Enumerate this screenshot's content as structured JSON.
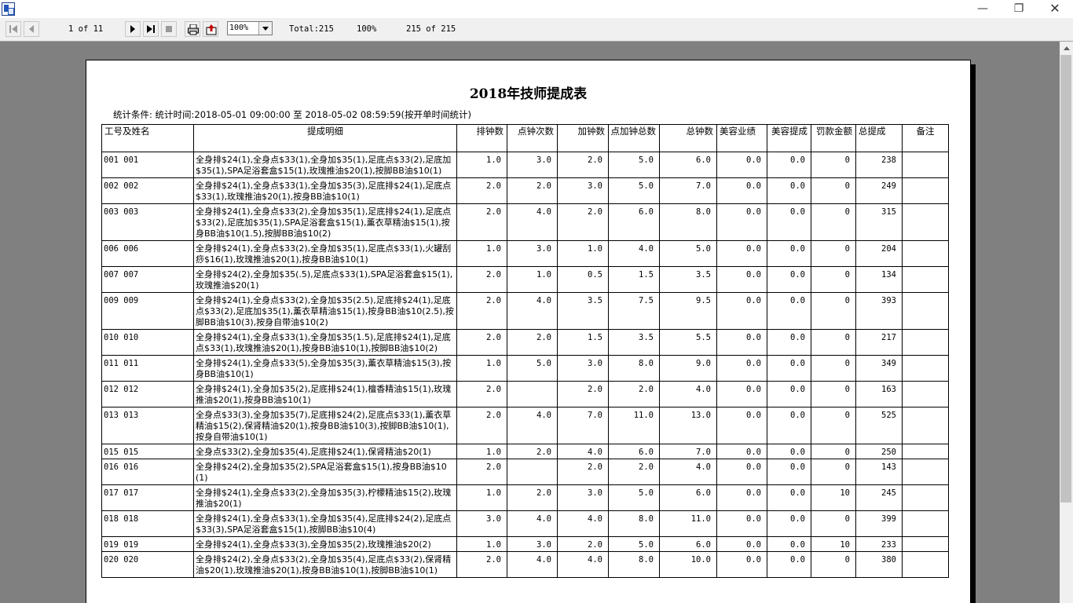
{
  "window": {
    "min_glyph": "—",
    "max_glyph": "❐",
    "close_glyph": "✕"
  },
  "icons": {
    "app": "report-viewer-icon",
    "first": "first-page-icon",
    "prev": "previous-page-icon",
    "next": "next-page-icon",
    "last": "last-page-icon",
    "stop": "stop-icon",
    "print": "printer-icon",
    "export": "export-icon"
  },
  "toolbar": {
    "page_indicator": "1 of 11",
    "zoom_value": "100%",
    "total": "Total:215",
    "percent": "100%",
    "records": "215 of 215"
  },
  "report": {
    "title": "2018年技师提成表",
    "condition": "统计条件: 统计时间:2018-05-01 09:00:00 至 2018-05-02 08:59:59(按开单时间统计)",
    "columns": [
      "工号及姓名",
      "提成明细",
      "排钟数",
      "点钟次数",
      "加钟数",
      "点加钟总数",
      "总钟数",
      "美容业绩",
      "美容提成",
      "罚款金额",
      "总提成",
      "备注"
    ],
    "rows": [
      {
        "id": "001 001",
        "detail": "全身排$24(1),全身点$33(1),全身加$35(1),足底点$33(2),足底加$35(1),SPA足浴套盒$15(1),玫瑰推油$20(1),按脚BB油$10(1)",
        "pai": "1.0",
        "dianci": "3.0",
        "jia": "2.0",
        "djz": "5.0",
        "zong": "6.0",
        "mryj": "0.0",
        "mrtc": "0.0",
        "fk": "0",
        "ztc": "238",
        "bz": ""
      },
      {
        "id": "002 002",
        "detail": "全身排$24(1),全身点$33(1),全身加$35(3),足底排$24(1),足底点$33(1),玫瑰推油$20(1),按身BB油$10(1)",
        "pai": "2.0",
        "dianci": "2.0",
        "jia": "3.0",
        "djz": "5.0",
        "zong": "7.0",
        "mryj": "0.0",
        "mrtc": "0.0",
        "fk": "0",
        "ztc": "249",
        "bz": ""
      },
      {
        "id": "003 003",
        "detail": "全身排$24(1),全身点$33(2),全身加$35(1),足底排$24(1),足底点$33(2),足底加$35(1),SPA足浴套盒$15(1),薰衣草精油$15(1),按身BB油$10(1.5),按脚BB油$10(2)",
        "pai": "2.0",
        "dianci": "4.0",
        "jia": "2.0",
        "djz": "6.0",
        "zong": "8.0",
        "mryj": "0.0",
        "mrtc": "0.0",
        "fk": "0",
        "ztc": "315",
        "bz": ""
      },
      {
        "id": "006 006",
        "detail": "全身排$24(1),全身点$33(2),全身加$35(1),足底点$33(1),火罐刮痧$16(1),玫瑰推油$20(1),按身BB油$10(1)",
        "pai": "1.0",
        "dianci": "3.0",
        "jia": "1.0",
        "djz": "4.0",
        "zong": "5.0",
        "mryj": "0.0",
        "mrtc": "0.0",
        "fk": "0",
        "ztc": "204",
        "bz": ""
      },
      {
        "id": "007 007",
        "detail": "全身排$24(2),全身加$35(.5),足底点$33(1),SPA足浴套盒$15(1),玫瑰推油$20(1)",
        "pai": "2.0",
        "dianci": "1.0",
        "jia": "0.5",
        "djz": "1.5",
        "zong": "3.5",
        "mryj": "0.0",
        "mrtc": "0.0",
        "fk": "0",
        "ztc": "134",
        "bz": ""
      },
      {
        "id": "009 009",
        "detail": "全身排$24(1),全身点$33(2),全身加$35(2.5),足底排$24(1),足底点$33(2),足底加$35(1),薰衣草精油$15(1),按身BB油$10(2.5),按脚BB油$10(3),按身自带油$10(2)",
        "pai": "2.0",
        "dianci": "4.0",
        "jia": "3.5",
        "djz": "7.5",
        "zong": "9.5",
        "mryj": "0.0",
        "mrtc": "0.0",
        "fk": "0",
        "ztc": "393",
        "bz": ""
      },
      {
        "id": "010 010",
        "detail": "全身排$24(1),全身点$33(1),全身加$35(1.5),足底排$24(1),足底点$33(1),玫瑰推油$20(1),按身BB油$10(1),按脚BB油$10(2)",
        "pai": "2.0",
        "dianci": "2.0",
        "jia": "1.5",
        "djz": "3.5",
        "zong": "5.5",
        "mryj": "0.0",
        "mrtc": "0.0",
        "fk": "0",
        "ztc": "217",
        "bz": ""
      },
      {
        "id": "011 011",
        "detail": "全身排$24(1),全身点$33(5),全身加$35(3),薰衣草精油$15(3),按身BB油$10(1)",
        "pai": "1.0",
        "dianci": "5.0",
        "jia": "3.0",
        "djz": "8.0",
        "zong": "9.0",
        "mryj": "0.0",
        "mrtc": "0.0",
        "fk": "0",
        "ztc": "349",
        "bz": ""
      },
      {
        "id": "012 012",
        "detail": "全身排$24(1),全身加$35(2),足底排$24(1),檀香精油$15(1),玫瑰推油$20(1),按身BB油$10(1)",
        "pai": "2.0",
        "dianci": "",
        "jia": "2.0",
        "djz": "2.0",
        "zong": "4.0",
        "mryj": "0.0",
        "mrtc": "0.0",
        "fk": "0",
        "ztc": "163",
        "bz": ""
      },
      {
        "id": "013 013",
        "detail": "全身点$33(3),全身加$35(7),足底排$24(2),足底点$33(1),薰衣草精油$15(2),保肾精油$20(1),按身BB油$10(3),按脚BB油$10(1),按身自带油$10(1)",
        "pai": "2.0",
        "dianci": "4.0",
        "jia": "7.0",
        "djz": "11.0",
        "zong": "13.0",
        "mryj": "0.0",
        "mrtc": "0.0",
        "fk": "0",
        "ztc": "525",
        "bz": ""
      },
      {
        "id": "015 015",
        "detail": "全身点$33(2),全身加$35(4),足底排$24(1),保肾精油$20(1)",
        "pai": "1.0",
        "dianci": "2.0",
        "jia": "4.0",
        "djz": "6.0",
        "zong": "7.0",
        "mryj": "0.0",
        "mrtc": "0.0",
        "fk": "0",
        "ztc": "250",
        "bz": ""
      },
      {
        "id": "016 016",
        "detail": "全身排$24(2),全身加$35(2),SPA足浴套盒$15(1),按身BB油$10(1)",
        "pai": "2.0",
        "dianci": "",
        "jia": "2.0",
        "djz": "2.0",
        "zong": "4.0",
        "mryj": "0.0",
        "mrtc": "0.0",
        "fk": "0",
        "ztc": "143",
        "bz": ""
      },
      {
        "id": "017 017",
        "detail": "全身排$24(1),全身点$33(2),全身加$35(3),柠檬精油$15(2),玫瑰推油$20(1)",
        "pai": "1.0",
        "dianci": "2.0",
        "jia": "3.0",
        "djz": "5.0",
        "zong": "6.0",
        "mryj": "0.0",
        "mrtc": "0.0",
        "fk": "10",
        "ztc": "245",
        "bz": ""
      },
      {
        "id": "018 018",
        "detail": "全身排$24(1),全身点$33(1),全身加$35(4),足底排$24(2),足底点$33(3),SPA足浴套盒$15(1),按脚BB油$10(4)",
        "pai": "3.0",
        "dianci": "4.0",
        "jia": "4.0",
        "djz": "8.0",
        "zong": "11.0",
        "mryj": "0.0",
        "mrtc": "0.0",
        "fk": "0",
        "ztc": "399",
        "bz": ""
      },
      {
        "id": "019 019",
        "detail": "全身排$24(1),全身点$33(3),全身加$35(2),玫瑰推油$20(2)",
        "pai": "1.0",
        "dianci": "3.0",
        "jia": "2.0",
        "djz": "5.0",
        "zong": "6.0",
        "mryj": "0.0",
        "mrtc": "0.0",
        "fk": "10",
        "ztc": "233",
        "bz": ""
      },
      {
        "id": "020 020",
        "detail": "全身排$24(2),全身点$33(2),全身加$35(4),足底点$33(2),保肾精油$20(1),玫瑰推油$20(1),按身BB油$10(1),按脚BB油$10(1)",
        "pai": "2.0",
        "dianci": "4.0",
        "jia": "4.0",
        "djz": "8.0",
        "zong": "10.0",
        "mryj": "0.0",
        "mrtc": "0.0",
        "fk": "0",
        "ztc": "380",
        "bz": ""
      }
    ]
  }
}
